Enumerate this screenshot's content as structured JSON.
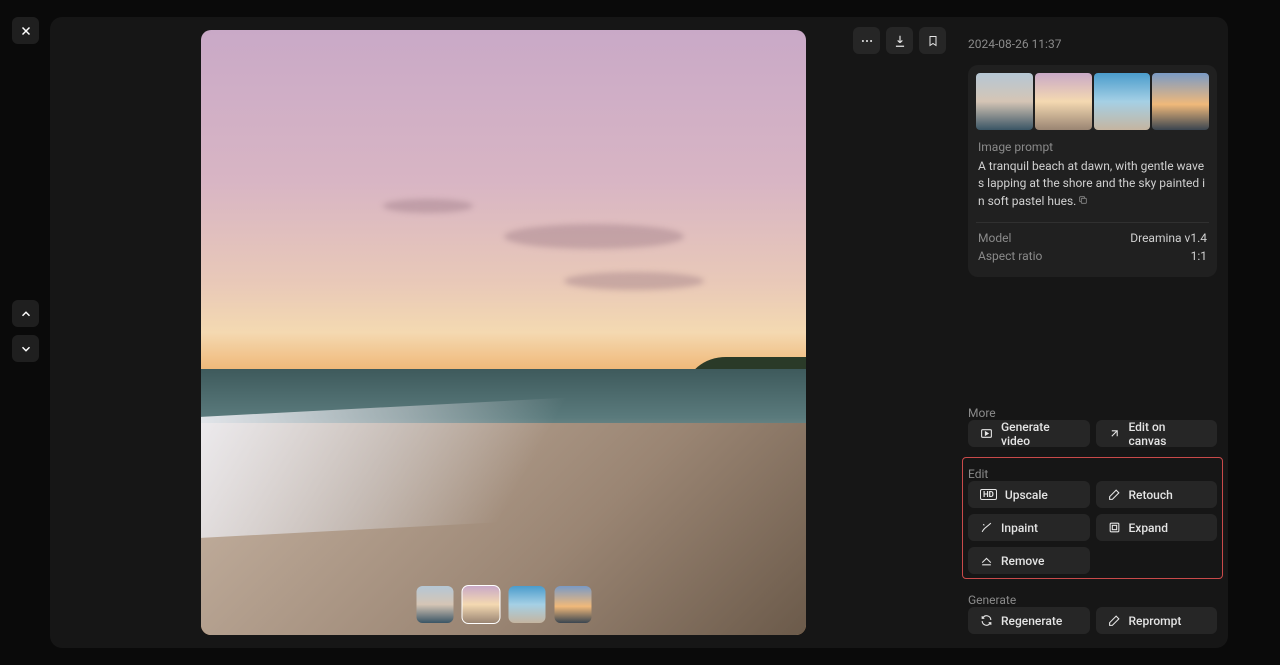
{
  "timestamp": "2024-08-26 11:37",
  "info": {
    "prompt_label": "Image prompt",
    "prompt_text": "A tranquil beach at dawn, with gentle waves lapping at the shore and the sky painted in soft pastel hues.",
    "model_label": "Model",
    "model_value": "Dreamina v1.4",
    "aspect_label": "Aspect ratio",
    "aspect_value": "1:1"
  },
  "sections": {
    "more": "More",
    "edit": "Edit",
    "generate": "Generate"
  },
  "actions": {
    "generate_video": "Generate video",
    "edit_canvas": "Edit on canvas",
    "upscale": "Upscale",
    "retouch": "Retouch",
    "inpaint": "Inpaint",
    "expand": "Expand",
    "remove": "Remove",
    "regenerate": "Regenerate",
    "reprompt": "Reprompt"
  }
}
